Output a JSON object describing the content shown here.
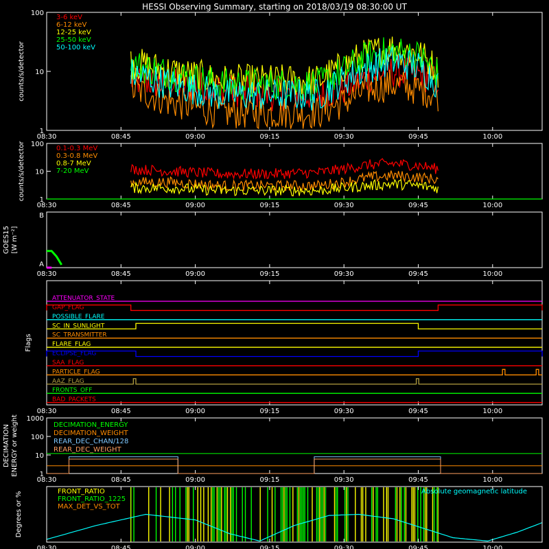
{
  "title": "HESSI Observing Summary, starting on 2018/03/19 08:30:00 UT",
  "time_ticks": [
    "08:30",
    "08:45",
    "09:00",
    "09:15",
    "09:30",
    "09:45",
    "10:00"
  ],
  "colors": {
    "background": "#000000",
    "axis": "#ffffff",
    "red": "#ff0000",
    "orange": "#ff8c00",
    "yellow": "#ffff00",
    "green": "#00ff00",
    "cyan": "#00ffff",
    "magenta": "#ff00ff",
    "blue": "#0000ff",
    "peach": "#ffa060",
    "olive": "#b4a040",
    "lightgreen": "#80ff80"
  },
  "chart_data": [
    {
      "type": "line",
      "ylabel": "counts/s/detector",
      "yscale": "log",
      "ylim": [
        1,
        100
      ],
      "y_ticks": [
        "1",
        "10",
        "100"
      ],
      "xlim_minutes": [
        0,
        100
      ],
      "legend_placement": "top-left",
      "series": [
        {
          "name": "3-6 keV",
          "color": "#ff0000",
          "x": [
            17,
            25,
            35,
            45,
            55,
            60,
            65,
            70,
            75,
            79
          ],
          "y": [
            7,
            6,
            5,
            4,
            4,
            5,
            8,
            10,
            9,
            7
          ]
        },
        {
          "name": "6-12 keV",
          "color": "#ff8c00",
          "x": [
            17,
            25,
            35,
            45,
            55,
            60,
            65,
            70,
            75,
            79
          ],
          "y": [
            5,
            3,
            2,
            2,
            2,
            3,
            5,
            6,
            5,
            4
          ]
        },
        {
          "name": "12-25 keV",
          "color": "#ffff00",
          "x": [
            17,
            25,
            35,
            45,
            55,
            60,
            65,
            70,
            75,
            79
          ],
          "y": [
            14,
            10,
            7,
            7,
            7,
            12,
            20,
            25,
            20,
            10
          ]
        },
        {
          "name": "25-50 keV",
          "color": "#00ff00",
          "x": [
            17,
            25,
            35,
            45,
            55,
            60,
            65,
            70,
            75,
            79
          ],
          "y": [
            13,
            9,
            6,
            6,
            6,
            10,
            18,
            22,
            18,
            9
          ]
        },
        {
          "name": "50-100 keV",
          "color": "#00ffff",
          "x": [
            17,
            25,
            35,
            45,
            55,
            60,
            65,
            70,
            75,
            79
          ],
          "y": [
            9,
            6,
            4,
            4,
            4,
            7,
            12,
            15,
            12,
            6
          ]
        }
      ]
    },
    {
      "type": "line",
      "ylabel": "counts/s/detector",
      "yscale": "log",
      "ylim": [
        1,
        100
      ],
      "y_ticks": [
        "1",
        "10",
        "100"
      ],
      "xlim_minutes": [
        0,
        100
      ],
      "legend_placement": "top-left",
      "series": [
        {
          "name": "0.1-0.3 MeV",
          "color": "#ff0000",
          "x": [
            17,
            25,
            35,
            45,
            55,
            60,
            65,
            70,
            75,
            79
          ],
          "y": [
            12,
            10,
            8,
            8,
            9,
            12,
            17,
            19,
            16,
            12
          ]
        },
        {
          "name": "0.3-0.8 MeV",
          "color": "#ff8c00",
          "x": [
            17,
            25,
            35,
            45,
            55,
            60,
            65,
            70,
            75,
            79
          ],
          "y": [
            4,
            4,
            3,
            3,
            3,
            4,
            6,
            7,
            6,
            5
          ]
        },
        {
          "name": "0.8-7 MeV",
          "color": "#ffff00",
          "x": [
            17,
            25,
            35,
            45,
            55,
            60,
            65,
            70,
            75,
            79
          ],
          "y": [
            2.5,
            2.5,
            2,
            2,
            2,
            2.5,
            3,
            3.5,
            3,
            2.5
          ]
        },
        {
          "name": "7-20 MeV",
          "color": "#00ff00",
          "x": [
            0,
            100
          ],
          "y": [
            1,
            1
          ]
        }
      ]
    },
    {
      "type": "line",
      "ylabel": "GOES15",
      "ylabel2": "[W m⁻²]",
      "ylim_labels": [
        "A",
        "B"
      ],
      "xlim_minutes": [
        0,
        100
      ],
      "series": [
        {
          "color": "#00ff00",
          "x": [
            0,
            1,
            2,
            3
          ],
          "y": [
            0.3,
            0.3,
            0.2,
            0.05
          ]
        },
        {
          "color": "#ff00ff",
          "x": [
            0,
            1
          ],
          "y": [
            0.0,
            0.0
          ]
        }
      ]
    },
    {
      "type": "line",
      "ylabel": "Flags",
      "xlim_minutes": [
        0,
        100
      ],
      "flags": [
        {
          "name": "ATTENUATOR_STATE",
          "color": "#ff00ff",
          "high": []
        },
        {
          "name": "GAP_FLAG",
          "color": "#ff0000",
          "high": [
            [
              0,
              17
            ],
            [
              79,
              100
            ]
          ]
        },
        {
          "name": "POSSIBLE_FLARE",
          "color": "#00ffff",
          "high": []
        },
        {
          "name": "SC_IN_SUNLIGHT",
          "color": "#ffff00",
          "high": [
            [
              18,
              75
            ]
          ]
        },
        {
          "name": "SC_TRANSMITTER",
          "color": "#ff8c00",
          "high": []
        },
        {
          "name": "FLARE_FLAG",
          "color": "#ffff00",
          "high": []
        },
        {
          "name": "ECLIPSE_FLAG",
          "color": "#0000ff",
          "high": [
            [
              0,
              18
            ],
            [
              75,
              100
            ]
          ]
        },
        {
          "name": "SAA_FLAG",
          "color": "#ff0000",
          "high": []
        },
        {
          "name": "PARTICLE_FLAG",
          "color": "#ff8c00",
          "high": [
            [
              92,
              92.5
            ],
            [
              98.8,
              99.3
            ]
          ]
        },
        {
          "name": "AAZ_FLAG",
          "color": "#b4a040",
          "high": [
            [
              17.5,
              18
            ],
            [
              74.6,
              75.1
            ]
          ]
        },
        {
          "name": "FRONTS_OFF",
          "color": "#00ff00",
          "high": []
        },
        {
          "name": "BAD_PACKETS",
          "color": "#ff0000",
          "high": []
        }
      ]
    },
    {
      "type": "line",
      "ylabel": "DECIMATION",
      "ylabel2": "ENERGY or weight",
      "yscale": "log",
      "ylim": [
        1,
        1000
      ],
      "y_ticks": [
        "1",
        "10",
        "100",
        "1000"
      ],
      "xlim_minutes": [
        0,
        100
      ],
      "legend_placement": "top-left",
      "series": [
        {
          "name": "DECIMATION_ENERGY",
          "color": "#00ff00",
          "x": [
            0,
            100
          ],
          "y": [
            12,
            12
          ]
        },
        {
          "name": "DECIMATION_WEIGHT",
          "color": "#ff8c00",
          "x": [
            0,
            100
          ],
          "y": [
            2.6,
            2.6
          ]
        },
        {
          "name": "REAR_DEC_CHAN/128",
          "color": "#80c8ff",
          "x": [
            0,
            4.5,
            4.5,
            26.5,
            26.5,
            54,
            54,
            79.5,
            79.5,
            100
          ],
          "y": [
            1,
            1,
            8,
            8,
            1,
            1,
            8,
            8,
            1,
            1
          ]
        },
        {
          "name": "REAR_DEC_WEIGHT",
          "color": "#ffa060",
          "x": [
            0,
            4.5,
            4.5,
            26.5,
            26.5,
            54,
            54,
            79.5,
            79.5,
            100
          ],
          "y": [
            1,
            1,
            6,
            6,
            1,
            1,
            6,
            6,
            1,
            1
          ]
        }
      ]
    },
    {
      "type": "line",
      "ylabel": "Degrees or %",
      "ylim": [
        0,
        100
      ],
      "xlim_minutes": [
        0,
        100
      ],
      "legend_placement": "top-left",
      "annotation": "Absolute geomagnetic latitude",
      "series": [
        {
          "name": "FRONT_RATIO",
          "color": "#ffff00"
        },
        {
          "name": "FRONT_RATIO_1225",
          "color": "#00ff00"
        },
        {
          "name": "MAX_DET_VS_TOT",
          "color": "#ff8c00"
        }
      ],
      "latitude": {
        "color": "#00ffff",
        "x": [
          0,
          10,
          20,
          30,
          37,
          43,
          50,
          57,
          63,
          70,
          76,
          82,
          89,
          95,
          100
        ],
        "y": [
          5,
          30,
          50,
          40,
          15,
          2,
          30,
          48,
          50,
          42,
          25,
          8,
          2,
          18,
          35
        ]
      },
      "ratio_band_minutes": [
        17,
        79
      ]
    }
  ]
}
